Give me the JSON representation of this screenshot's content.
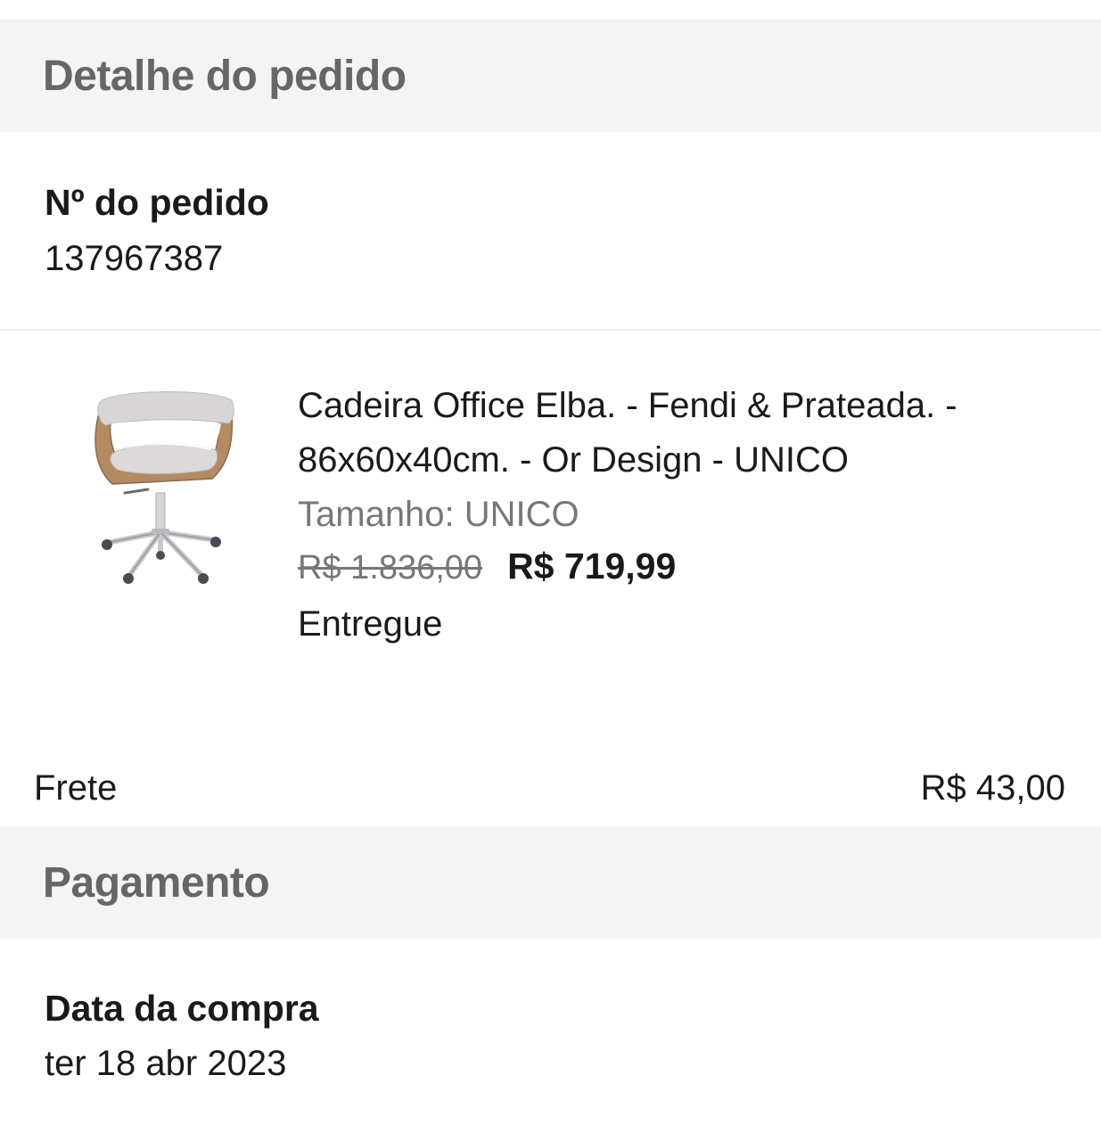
{
  "order_detail": {
    "section_title": "Detalhe do pedido",
    "order_number_label": "Nº do pedido",
    "order_number": "137967387"
  },
  "product": {
    "image_icon": "office-chair-image",
    "name": "Cadeira Office Elba. - Fendi & Prateada. - 86x60x40cm. - Or Design - UNICO",
    "size": "Tamanho: UNICO",
    "original_price": "R$ 1.836,00",
    "price": "R$ 719,99",
    "status": "Entregue"
  },
  "shipping": {
    "label": "Frete",
    "value": "R$ 43,00"
  },
  "payment": {
    "section_title": "Pagamento",
    "purchase_date_label": "Data da compra",
    "purchase_date": "ter 18 abr 2023"
  },
  "colors": {
    "header_background": "#f4f4f4",
    "header_text": "#666666",
    "primary_text": "#1a1a1a",
    "secondary_text": "#777777"
  }
}
